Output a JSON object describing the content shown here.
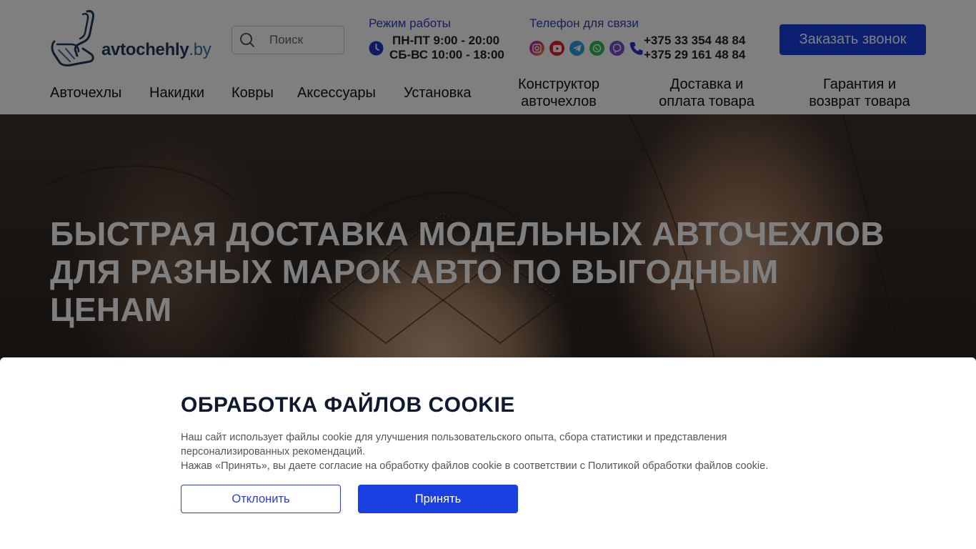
{
  "header": {
    "logo": {
      "name": "avtochehly",
      "tld": ".by"
    },
    "search": {
      "placeholder": "Поиск"
    },
    "hours": {
      "title": "Режим работы",
      "weekdays": "ПН-ПТ 9:00 - 20:00",
      "weekend": "СБ-ВС 10:00 - 18:00"
    },
    "contacts": {
      "title": "Телефон для связи",
      "phone1": "+375 33 354 48 84",
      "phone2": "+375 29 161 48 84",
      "socials": [
        "instagram-icon",
        "youtube-icon",
        "telegram-icon",
        "whatsapp-icon",
        "viber-icon"
      ]
    },
    "callback_label": "Заказать звонок"
  },
  "nav": [
    {
      "label": "Авточехлы"
    },
    {
      "label": "Накидки"
    },
    {
      "label": "Ковры"
    },
    {
      "label": "Аксессуары"
    },
    {
      "label": "Установка"
    },
    {
      "label": "Конструктор авточехлов"
    },
    {
      "label": "Доставка и оплата товара"
    },
    {
      "label": "Гарантия и возврат товара"
    }
  ],
  "hero": {
    "title": "БЫСТРАЯ ДОСТАВКА МОДЕЛЬНЫХ АВТОЧЕХЛОВ ДЛЯ РАЗНЫХ МАРОК АВТО ПО ВЫГОДНЫМ ЦЕНАМ"
  },
  "cookie": {
    "title": "ОБРАБОТКА ФАЙЛОВ COOKIE",
    "line1": "Наш сайт использует файлы cookie для улучшения пользовательского опыта, сбора статистики и представления",
    "line2": "персонализированных рекомендаций.",
    "line3": "Нажав «Принять», вы даете согласие на обработку файлов cookie в соответствии с Политикой обработки файлов cookie.",
    "decline_label": "Отклонить",
    "accept_label": "Принять"
  },
  "colors": {
    "accent": "#1a3fe0",
    "link": "#2f3cc8",
    "logo": "#1f3a5f"
  }
}
